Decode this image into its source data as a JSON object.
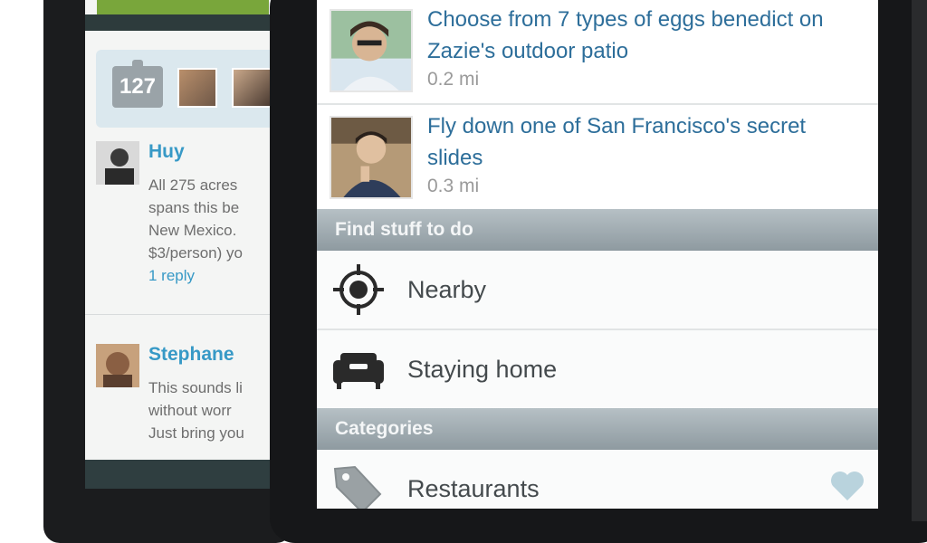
{
  "back_screen": {
    "checkin_count": "127",
    "comments": [
      {
        "name": "Huy",
        "text_lines": [
          "All 275 acres",
          "spans this be",
          "New Mexico.",
          "$3/person) yo"
        ],
        "reply": "1 reply"
      },
      {
        "name": "Stephane",
        "text_lines": [
          "This sounds li",
          "without worr",
          "Just bring you"
        ]
      }
    ]
  },
  "front_screen": {
    "feed": [
      {
        "title": "Choose from 7 types of eggs benedict on Zazie's outdoor patio",
        "distance": "0.2 mi"
      },
      {
        "title": "Fly down one of San Francisco's secret slides",
        "distance": "0.3 mi"
      }
    ],
    "find_section": {
      "header": "Find stuff to do",
      "items": [
        {
          "label": "Nearby",
          "icon": "location-target-icon"
        },
        {
          "label": "Staying home",
          "icon": "sofa-icon"
        }
      ]
    },
    "categories_section": {
      "header": "Categories",
      "items": [
        {
          "label": "Restaurants",
          "icon": "tag-icon",
          "favorite_icon": "heart-icon"
        }
      ]
    }
  },
  "colors": {
    "link_blue": "#2d6e9a",
    "name_blue": "#3799c6",
    "section_header": "#9aa5ab",
    "accent_green": "#79a63b"
  }
}
